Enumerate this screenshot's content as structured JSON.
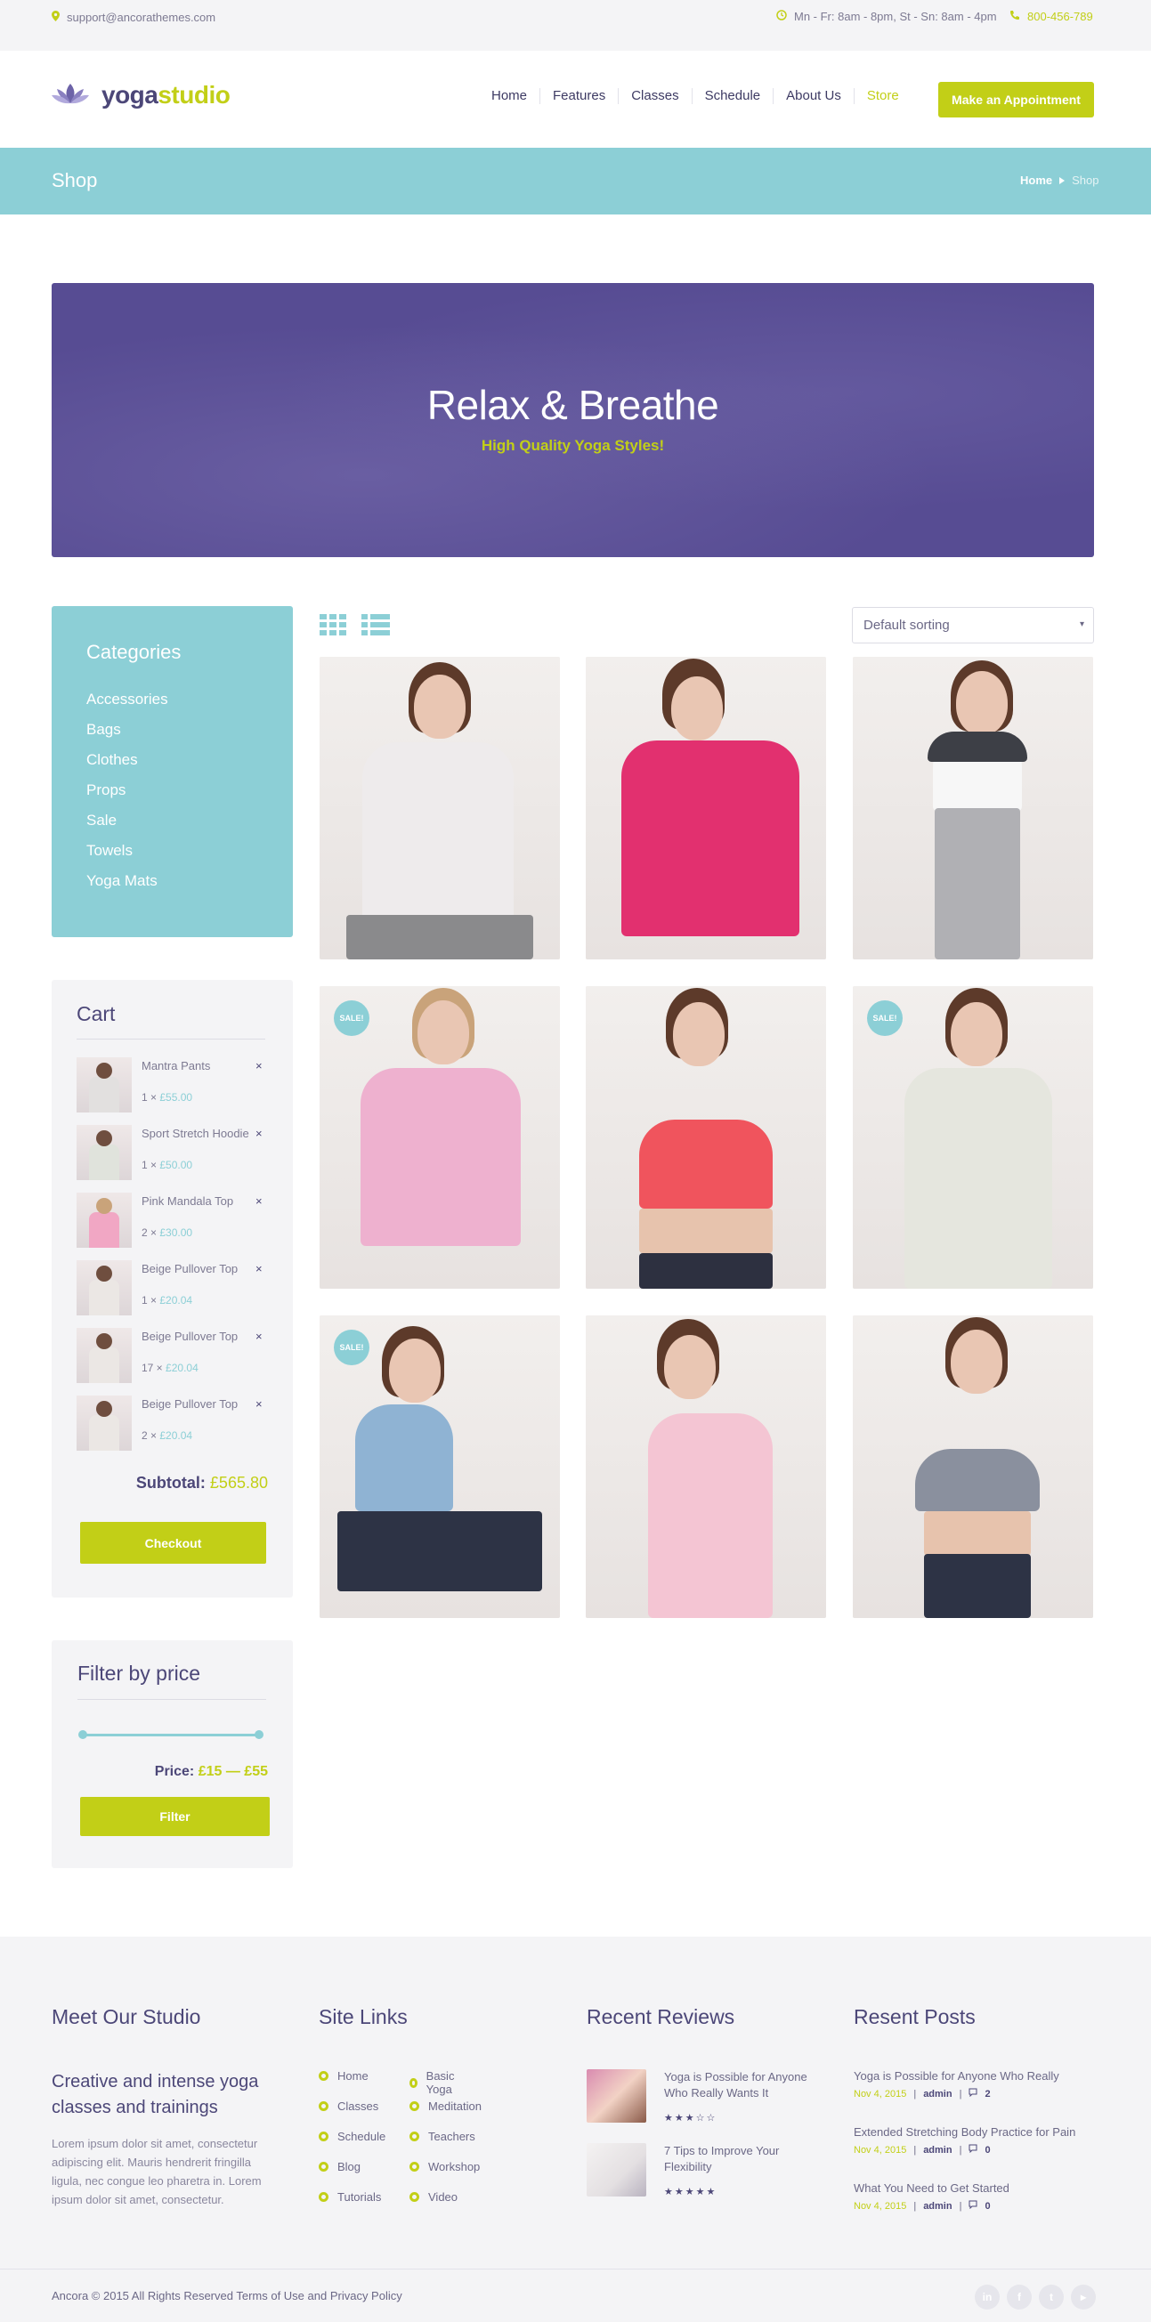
{
  "topbar": {
    "email": "support@ancorathemes.com",
    "hours": "Mn - Fr: 8am - 8pm, St - Sn: 8am - 4pm",
    "phone": "800-456-789"
  },
  "header": {
    "logo_part1": "yoga",
    "logo_part2": "studio",
    "nav": [
      "Home",
      "Features",
      "Classes",
      "Schedule",
      "About Us",
      "Store"
    ],
    "cta": "Make an Appointment"
  },
  "titlebar": {
    "title": "Shop",
    "breadcrumb_home": "Home",
    "breadcrumb_current": "Shop"
  },
  "hero": {
    "title": "Relax & Breathe",
    "subtitle": "High Quality Yoga Styles!"
  },
  "categories": {
    "title": "Categories",
    "items": [
      "Accessories",
      "Bags",
      "Clothes",
      "Props",
      "Sale",
      "Towels",
      "Yoga Mats"
    ]
  },
  "cart": {
    "title": "Cart",
    "items": [
      {
        "name": "Mantra Pants",
        "qty": "1 ×",
        "price": "£55.00"
      },
      {
        "name": "Sport Stretch Hoodie",
        "qty": "1 ×",
        "price": "£50.00"
      },
      {
        "name": "Pink Mandala Top",
        "qty": "2 ×",
        "price": "£30.00"
      },
      {
        "name": "Beige Pullover Top",
        "qty": "1 ×",
        "price": "£20.04"
      },
      {
        "name": "Beige Pullover Top",
        "qty": "17 ×",
        "price": "£20.04"
      },
      {
        "name": "Beige Pullover Top",
        "qty": "2 ×",
        "price": "£20.04"
      }
    ],
    "remove_glyph": "×",
    "subtotal_label": "Subtotal:",
    "subtotal_value": "£565.80",
    "checkout": "Checkout"
  },
  "filter": {
    "title": "Filter by price",
    "price_label": "Price:",
    "price_min": "£15",
    "price_dash": "—",
    "price_max": "£55",
    "button": "Filter"
  },
  "shop": {
    "sort_selected": "Default sorting",
    "sale_badge": "SALE!"
  },
  "footer": {
    "col1_title": "Meet Our Studio",
    "col1_tagline": "Creative and intense yoga classes and trainings",
    "col1_text": "Lorem ipsum dolor sit amet, consectetur adipiscing elit. Mauris hendrerit fringilla ligula, nec congue leo pharetra in. Lorem ipsum dolor sit amet, consectetur.",
    "col2_title": "Site Links",
    "links_left": [
      "Home",
      "Classes",
      "Schedule",
      "Blog",
      "Tutorials"
    ],
    "links_right": [
      "Basic Yoga",
      "Meditation",
      "Teachers",
      "Workshop",
      "Video"
    ],
    "col3_title": "Recent Reviews",
    "reviews": [
      {
        "title": "Yoga is Possible for Anyone Who Really Wants It",
        "stars": "★★★☆☆"
      },
      {
        "title": "7 Tips to Improve Your Flexibility",
        "stars": "★★★★★"
      }
    ],
    "col4_title": "Resent Posts",
    "posts": [
      {
        "title": "Yoga is Possible for Anyone Who Really",
        "date": "Nov 4, 2015",
        "author": "admin",
        "comments": "2"
      },
      {
        "title": "Extended Stretching Body Practice for Pain",
        "date": "Nov 4, 2015",
        "author": "admin",
        "comments": "0"
      },
      {
        "title": "What You Need to Get Started",
        "date": "Nov 4, 2015",
        "author": "admin",
        "comments": "0"
      }
    ],
    "copyright": "Ancora © 2015 All Rights Reserved Terms of Use and Privacy Policy",
    "social": [
      "in",
      "f",
      "t",
      "▸"
    ]
  },
  "colors": {
    "accent": "#c2cf17",
    "teal": "#8ccfd6",
    "brand_purple": "#4c4778",
    "hero_bg": "#574c93"
  }
}
